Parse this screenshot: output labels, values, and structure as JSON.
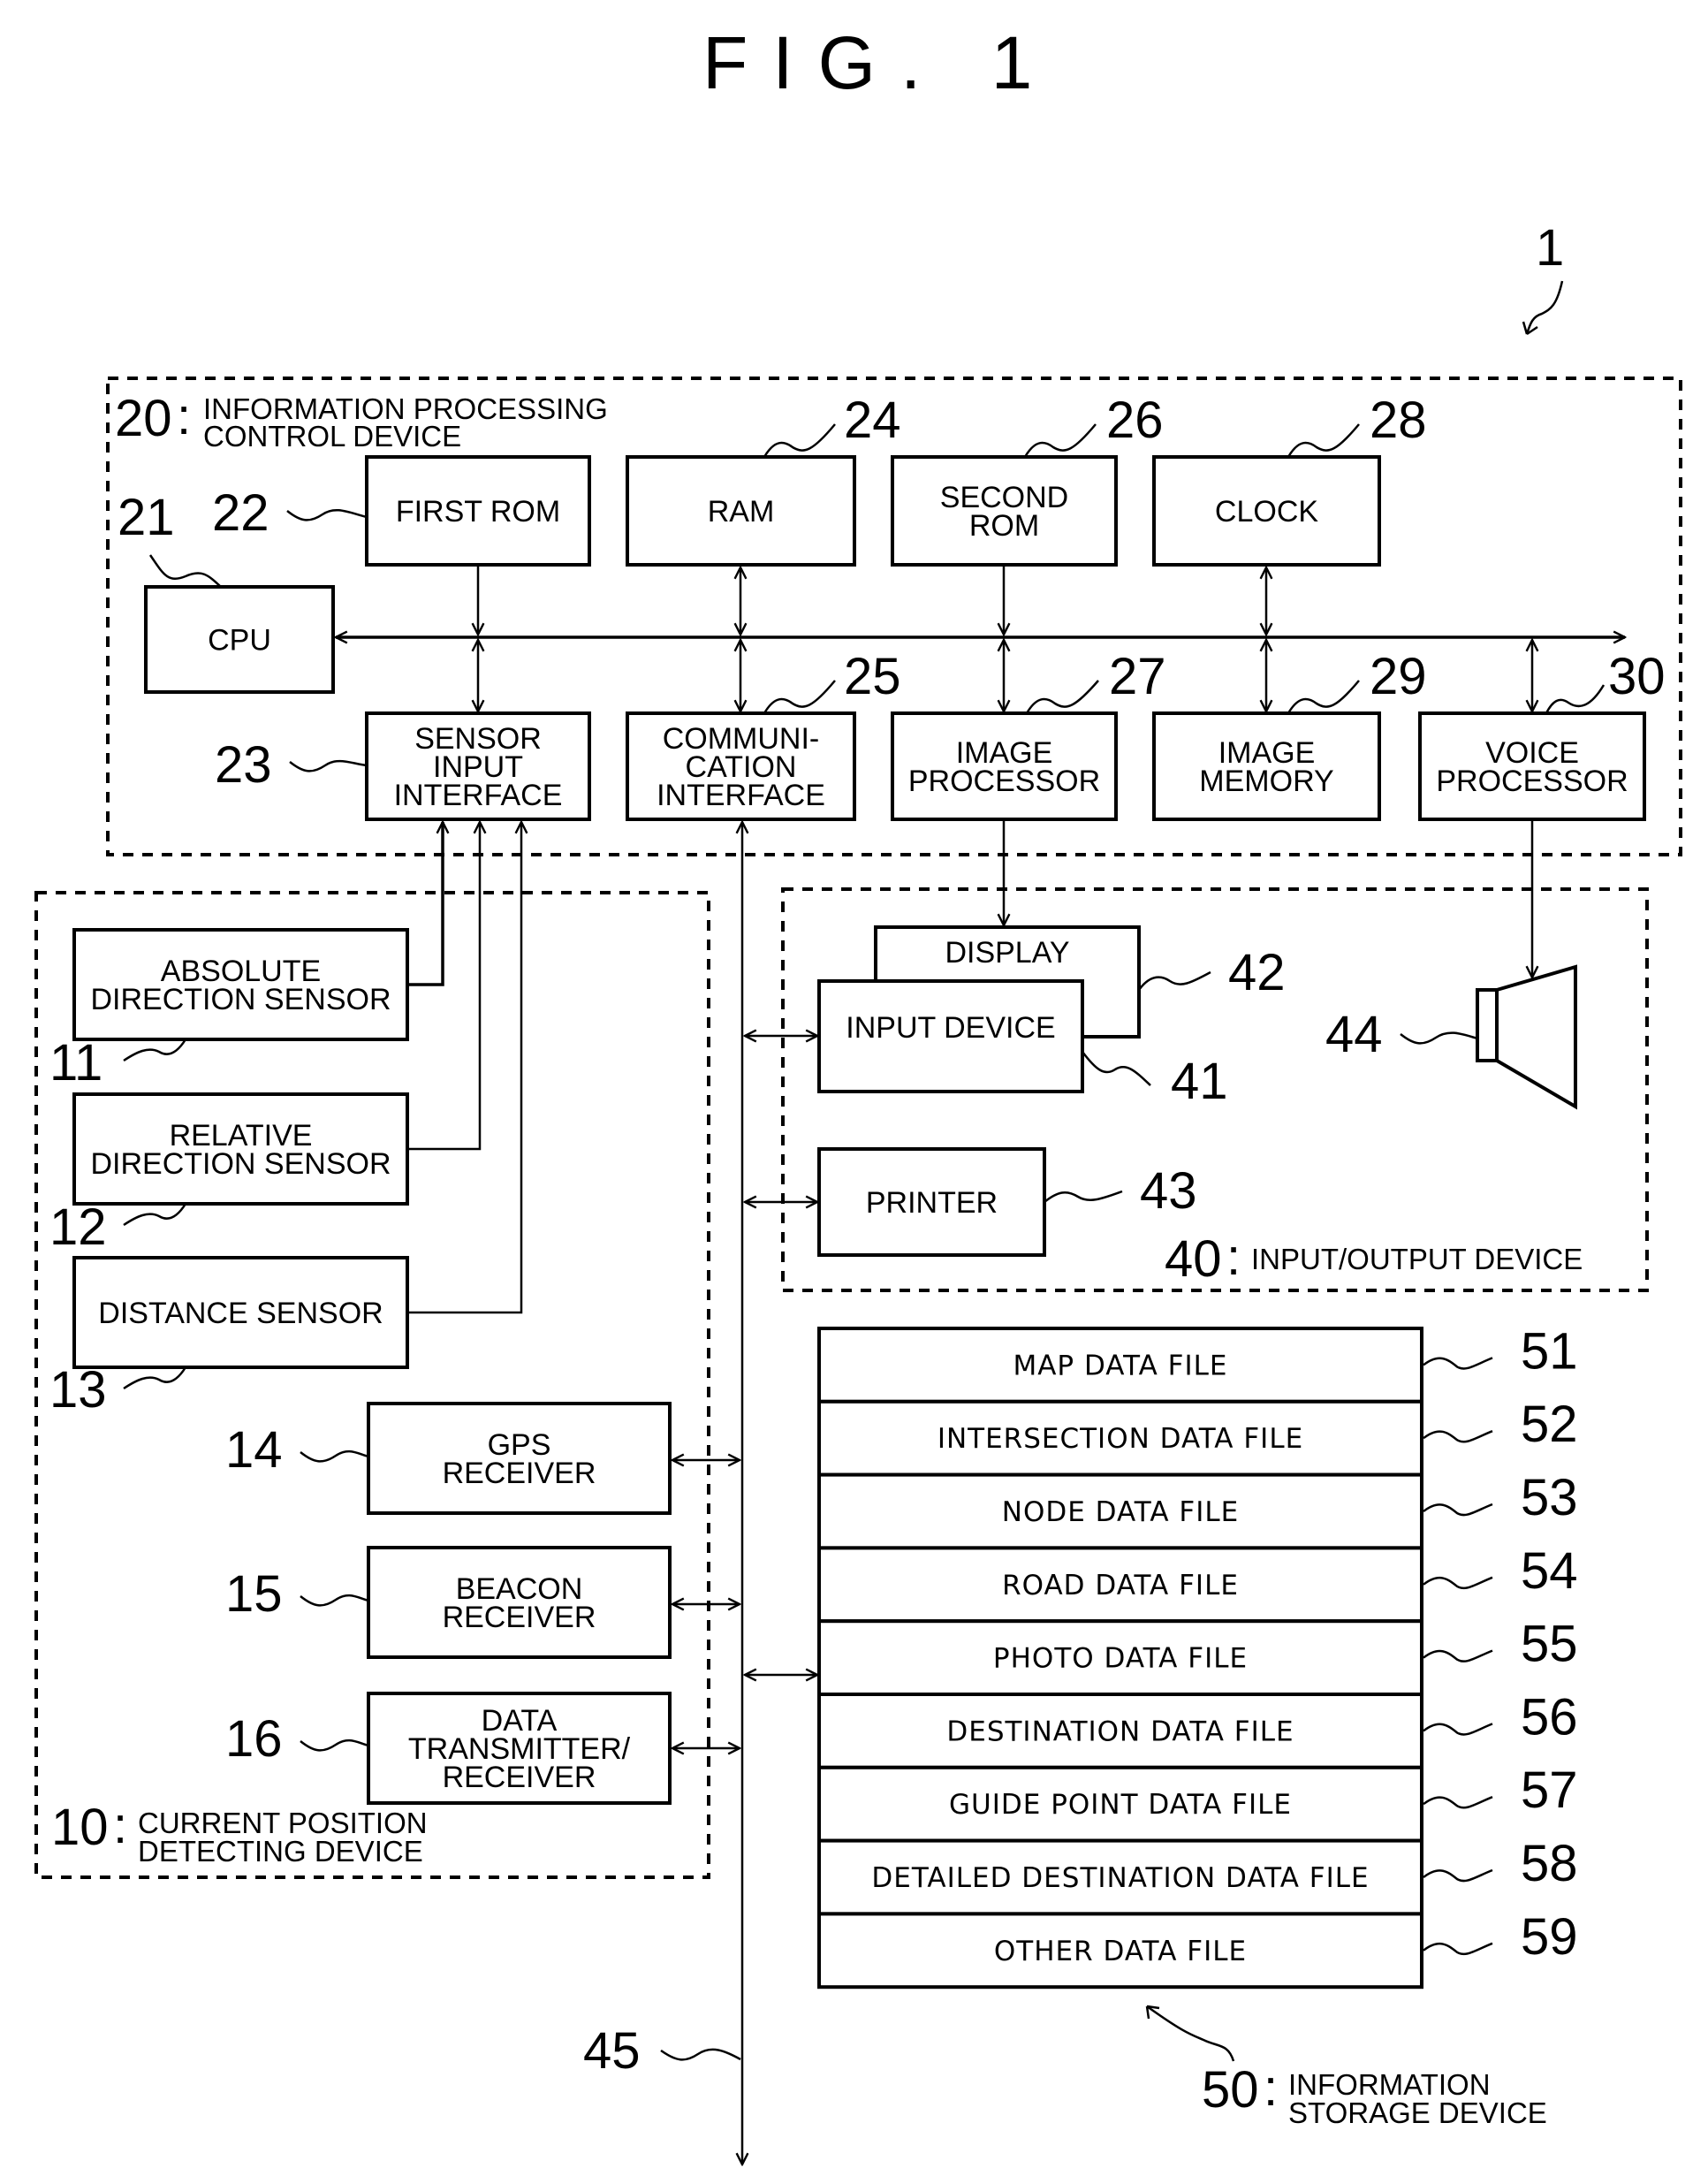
{
  "figure": {
    "title": "FIG. 1",
    "system_ref": "1"
  },
  "groups": {
    "control": {
      "ref": "20",
      "label_line1": "INFORMATION PROCESSING",
      "label_line2": "CONTROL DEVICE"
    },
    "position": {
      "ref": "10",
      "label_line1": "CURRENT POSITION",
      "label_line2": "DETECTING DEVICE"
    },
    "io": {
      "ref": "40",
      "label_line1": "INPUT/OUTPUT DEVICE"
    },
    "storage": {
      "ref": "50",
      "label_line1": "INFORMATION",
      "label_line2": "STORAGE DEVICE"
    }
  },
  "blocks": {
    "cpu": {
      "ref": "21",
      "lines": [
        "CPU"
      ]
    },
    "first_rom": {
      "ref": "22",
      "lines": [
        "FIRST ROM"
      ]
    },
    "sensor_if": {
      "ref": "23",
      "lines": [
        "SENSOR",
        "INPUT",
        "INTERFACE"
      ]
    },
    "ram": {
      "ref": "24",
      "lines": [
        "RAM"
      ]
    },
    "comm_if": {
      "ref": "25",
      "lines": [
        "COMMUNI-",
        "CATION",
        "INTERFACE"
      ]
    },
    "second_rom": {
      "ref": "26",
      "lines": [
        "SECOND",
        "ROM"
      ]
    },
    "image_proc": {
      "ref": "27",
      "lines": [
        "IMAGE",
        "PROCESSOR"
      ]
    },
    "clock": {
      "ref": "28",
      "lines": [
        "CLOCK"
      ]
    },
    "image_mem": {
      "ref": "29",
      "lines": [
        "IMAGE",
        "MEMORY"
      ]
    },
    "voice_proc": {
      "ref": "30",
      "lines": [
        "VOICE",
        "PROCESSOR"
      ]
    },
    "abs_sensor": {
      "ref": "11",
      "lines": [
        "ABSOLUTE",
        "DIRECTION SENSOR"
      ]
    },
    "rel_sensor": {
      "ref": "12",
      "lines": [
        "RELATIVE",
        "DIRECTION SENSOR"
      ]
    },
    "dist_sensor": {
      "ref": "13",
      "lines": [
        "DISTANCE SENSOR"
      ]
    },
    "gps": {
      "ref": "14",
      "lines": [
        "GPS",
        "RECEIVER"
      ]
    },
    "beacon": {
      "ref": "15",
      "lines": [
        "BEACON",
        "RECEIVER"
      ]
    },
    "data_tx": {
      "ref": "16",
      "lines": [
        "DATA",
        "TRANSMITTER/",
        "RECEIVER"
      ]
    },
    "input_device": {
      "ref": "41",
      "lines": [
        "INPUT DEVICE"
      ]
    },
    "display": {
      "ref": "42",
      "lines": [
        "DISPLAY"
      ]
    },
    "printer": {
      "ref": "43",
      "lines": [
        "PRINTER"
      ]
    },
    "speaker": {
      "ref": "44"
    },
    "bus": {
      "ref": "45"
    }
  },
  "files": [
    {
      "ref": "51",
      "label": "MAP DATA FILE"
    },
    {
      "ref": "52",
      "label": "INTERSECTION DATA FILE"
    },
    {
      "ref": "53",
      "label": "NODE DATA FILE"
    },
    {
      "ref": "54",
      "label": "ROAD DATA FILE"
    },
    {
      "ref": "55",
      "label": "PHOTO DATA FILE"
    },
    {
      "ref": "56",
      "label": "DESTINATION DATA FILE"
    },
    {
      "ref": "57",
      "label": "GUIDE POINT DATA FILE"
    },
    {
      "ref": "58",
      "label": "DETAILED DESTINATION DATA FILE"
    },
    {
      "ref": "59",
      "label": "OTHER DATA FILE"
    }
  ]
}
